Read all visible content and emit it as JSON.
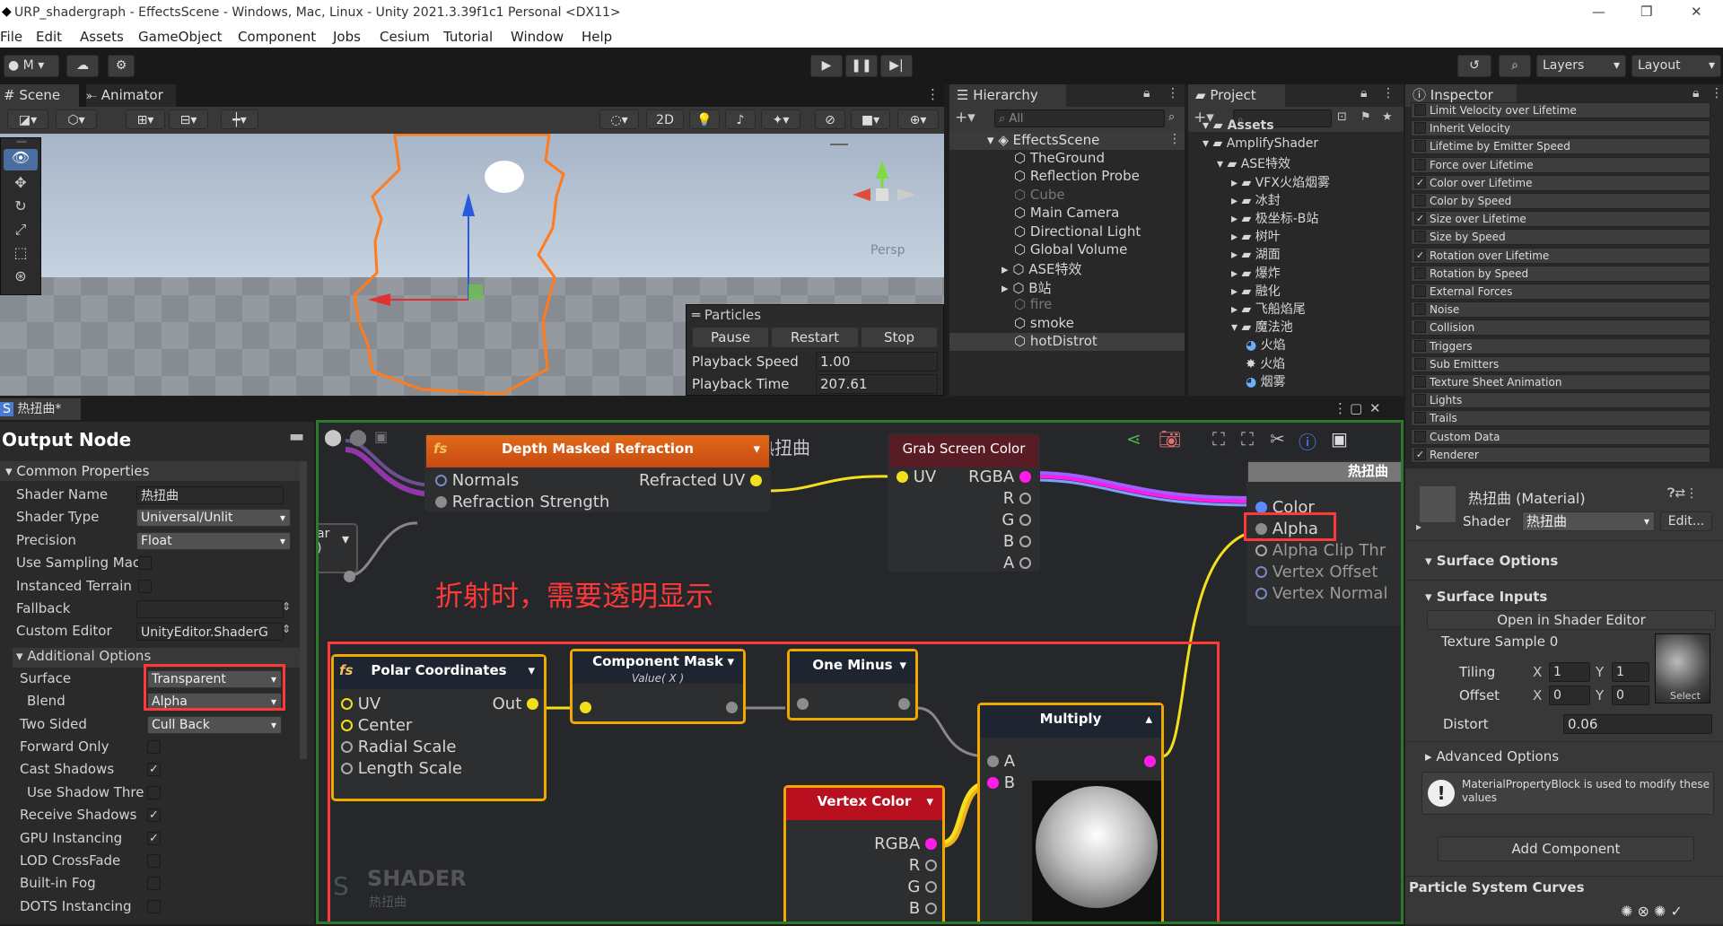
{
  "window": {
    "title": "URP_shadergraph - EffectsScene - Windows, Mac, Linux - Unity 2021.3.39f1c1 Personal <DX11>",
    "minimize": "—",
    "maximize": "❐",
    "close": "✕"
  },
  "menu": [
    "File",
    "Edit",
    "Assets",
    "GameObject",
    "Component",
    "Jobs",
    "Cesium",
    "Tutorial",
    "Window",
    "Help"
  ],
  "toolbar": {
    "account": "M",
    "layers": "Layers",
    "layout": "Layout"
  },
  "scene": {
    "tab_scene": "Scene",
    "tab_animator": "Animator",
    "btn_2d": "2D",
    "persp": "Persp",
    "particles": {
      "title": "Particles",
      "pause": "Pause",
      "restart": "Restart",
      "stop": "Stop",
      "speed_label": "Playback Speed",
      "speed": "1.00",
      "time_label": "Playback Time",
      "time": "207.61"
    }
  },
  "hierarchy": {
    "tab": "Hierarchy",
    "search": "All",
    "scene": "EffectsScene",
    "items": [
      {
        "label": "TheGround",
        "dim": false
      },
      {
        "label": "Reflection Probe",
        "dim": false
      },
      {
        "label": "Cube",
        "dim": true
      },
      {
        "label": "Main Camera",
        "dim": false
      },
      {
        "label": "Directional Light",
        "dim": false
      },
      {
        "label": "Global Volume",
        "dim": false
      },
      {
        "label": "ASE特效",
        "dim": false
      },
      {
        "label": "B站",
        "dim": false
      },
      {
        "label": "fire",
        "dim": true
      },
      {
        "label": "smoke",
        "dim": false
      },
      {
        "label": "hotDistrot",
        "dim": false
      }
    ]
  },
  "project": {
    "tab": "Project",
    "items": [
      "Assets",
      "AmplifyShader",
      "ASE特效",
      "VFX火焰烟雾",
      "冰封",
      "极坐标-B站",
      "树叶",
      "湖面",
      "爆炸",
      "融化",
      "飞船焰尾",
      "魔法池",
      "火焰",
      "火焰",
      "烟雾"
    ]
  },
  "inspector": {
    "tab": "Inspector",
    "modules": [
      {
        "label": "Limit Velocity over Lifetime",
        "on": false
      },
      {
        "label": "Inherit Velocity",
        "on": false
      },
      {
        "label": "Lifetime by Emitter Speed",
        "on": false
      },
      {
        "label": "Force over Lifetime",
        "on": false
      },
      {
        "label": "Color over Lifetime",
        "on": true
      },
      {
        "label": "Color by Speed",
        "on": false
      },
      {
        "label": "Size over Lifetime",
        "on": true
      },
      {
        "label": "Size by Speed",
        "on": false
      },
      {
        "label": "Rotation over Lifetime",
        "on": true
      },
      {
        "label": "Rotation by Speed",
        "on": false
      },
      {
        "label": "External Forces",
        "on": false
      },
      {
        "label": "Noise",
        "on": false
      },
      {
        "label": "Collision",
        "on": false
      },
      {
        "label": "Triggers",
        "on": false
      },
      {
        "label": "Sub Emitters",
        "on": false
      },
      {
        "label": "Texture Sheet Animation",
        "on": false
      },
      {
        "label": "Lights",
        "on": false
      },
      {
        "label": "Trails",
        "on": false
      },
      {
        "label": "Custom Data",
        "on": false
      },
      {
        "label": "Renderer",
        "on": true
      }
    ],
    "material": "热扭曲 (Material)",
    "shader_label": "Shader",
    "shader": "热扭曲",
    "edit": "Edit...",
    "surface_options": "Surface Options",
    "surface_inputs": "Surface Inputs",
    "open_editor": "Open in Shader Editor",
    "tex_label": "Texture Sample 0",
    "tiling": "Tiling",
    "offset": "Offset",
    "x": "X",
    "y": "Y",
    "tiling_x": "1",
    "tiling_y": "1",
    "offset_x": "0",
    "offset_y": "0",
    "select": "Select",
    "distort_label": "Distort",
    "distort": "0.06",
    "advanced": "Advanced Options",
    "warning": "MaterialPropertyBlock is used to modify these values",
    "add_component": "Add Component",
    "curves": "Particle System Curves"
  },
  "graph": {
    "tab": "热扭曲*",
    "output_node": "Output Node",
    "common": "Common Properties",
    "props": [
      {
        "label": "Shader Name",
        "value": "热扭曲"
      },
      {
        "label": "Shader Type",
        "value": "Universal/Unlit"
      },
      {
        "label": "Precision",
        "value": "Float"
      },
      {
        "label": "Use Sampling Mac",
        "value": ""
      },
      {
        "label": "Instanced Terrain",
        "value": ""
      },
      {
        "label": "Fallback",
        "value": ""
      },
      {
        "label": "Custom Editor",
        "value": "UnityEditor.ShaderG"
      }
    ],
    "additional": "Additional Options",
    "opts": [
      {
        "label": "Surface",
        "value": "Transparent"
      },
      {
        "label": "Blend",
        "value": "Alpha"
      },
      {
        "label": "Two Sided",
        "value": "Cull Back"
      }
    ],
    "checks": [
      {
        "label": "Forward Only",
        "on": false
      },
      {
        "label": "Cast Shadows",
        "on": true
      },
      {
        "label": "Use Shadow Thre",
        "on": false
      },
      {
        "label": "Receive Shadows",
        "on": true
      },
      {
        "label": "GPU Instancing",
        "on": true
      },
      {
        "label": "LOD CrossFade",
        "on": false
      },
      {
        "label": "Built-in Fog",
        "on": false
      },
      {
        "label": "DOTS Instancing",
        "on": false
      }
    ],
    "canvas_title": "热扭曲",
    "watermark": "SHADER",
    "watermark_sub": "热扭曲",
    "annotation": "折射时，需要透明显示",
    "dmr": {
      "title": "Depth Masked Refraction",
      "in1": "Normals",
      "in2": "Refraction Strength",
      "out": "Refracted UV"
    },
    "grab": {
      "title": "Grab Screen Color",
      "in": "UV",
      "out": [
        "RGBA",
        "R",
        "G",
        "B",
        "A"
      ]
    },
    "outnode": {
      "title": "热扭曲",
      "ports": [
        "Color",
        "Alpha",
        "Alpha Clip Thr",
        "Vertex Offset",
        "Vertex Normal"
      ]
    },
    "partial": {
      "title": "ar",
      "sub": ")"
    },
    "polar": {
      "title": "Polar Coordinates",
      "ports": [
        "UV",
        "Center",
        "Radial Scale",
        "Length Scale"
      ],
      "out": "Out"
    },
    "mask": {
      "title": "Component Mask",
      "sub": "Value( X )"
    },
    "oneminus": {
      "title": "One Minus"
    },
    "multiply": {
      "title": "Multiply",
      "ports": [
        "A",
        "B"
      ]
    },
    "vcolor": {
      "title": "Vertex Color",
      "outs": [
        "RGBA",
        "R",
        "G",
        "B"
      ]
    }
  }
}
